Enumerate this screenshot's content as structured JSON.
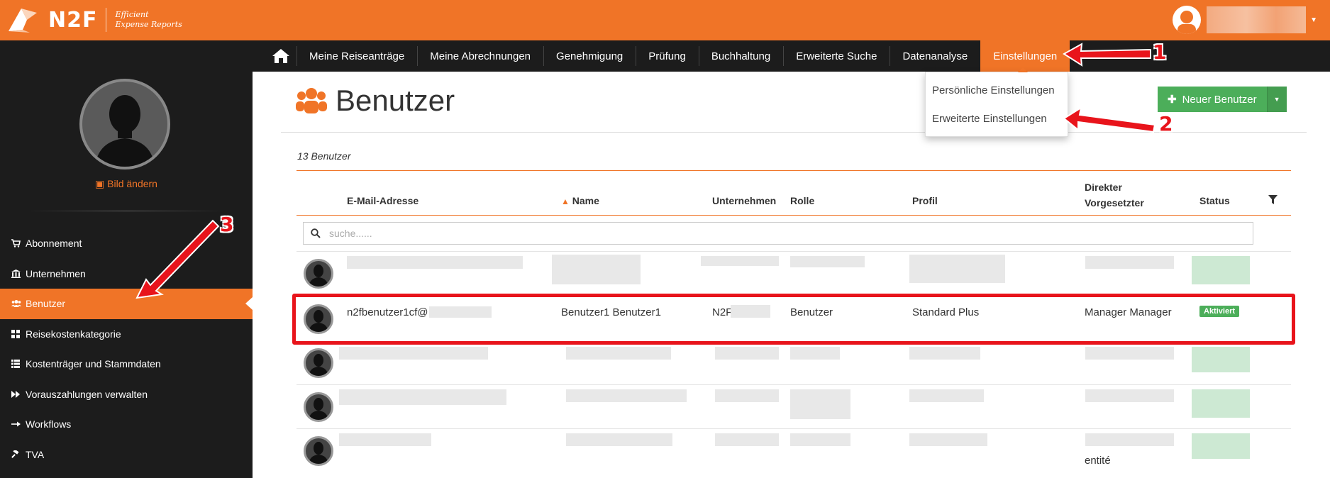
{
  "brand": {
    "name": "N2F",
    "tagline_line1": "Efficient",
    "tagline_line2": "Expense Reports"
  },
  "nav": {
    "items": [
      "Meine Reiseanträge",
      "Meine Abrechnungen",
      "Genehmigung",
      "Prüfung",
      "Buchhaltung",
      "Erweiterte Suche",
      "Datenanalyse",
      "Einstellungen"
    ],
    "active": "Einstellungen"
  },
  "dropdown": {
    "items": [
      "Persönliche Einstellungen",
      "Erweiterte Einstellungen"
    ]
  },
  "sidebar": {
    "change_picture": "Bild ändern",
    "items": [
      {
        "label": "Abonnement",
        "icon": "cart-icon"
      },
      {
        "label": "Unternehmen",
        "icon": "bank-icon"
      },
      {
        "label": "Benutzer",
        "icon": "users-icon",
        "active": true
      },
      {
        "label": "Reisekostenkategorie",
        "icon": "grid-icon"
      },
      {
        "label": "Kostenträger und Stammdaten",
        "icon": "list-icon"
      },
      {
        "label": "Vorauszahlungen verwalten",
        "icon": "fast-forward-icon"
      },
      {
        "label": "Workflows",
        "icon": "arrow-right-icon"
      },
      {
        "label": "TVA",
        "icon": "gavel-icon"
      }
    ]
  },
  "page": {
    "title": "Benutzer",
    "new_user_button": "Neuer Benutzer",
    "count": "13 Benutzer"
  },
  "table": {
    "headers": {
      "email": "E-Mail-Adresse",
      "name": "Name",
      "company": "Unternehmen",
      "role": "Rolle",
      "profile": "Profil",
      "manager_line1": "Direkter",
      "manager_line2": "Vorgesetzter",
      "status": "Status"
    },
    "search_placeholder": "suche......",
    "highlighted_row": {
      "email": "n2fbenutzer1cf@",
      "name": "Benutzer1 Benutzer1",
      "company": "N2F",
      "role": "Benutzer",
      "profile": "Standard Plus",
      "manager": "Manager Manager",
      "status": "Aktiviert"
    },
    "last_row_manager_fragment": "entité"
  },
  "annotations": {
    "one": "1",
    "two": "2",
    "three": "3"
  },
  "colors": {
    "accent": "#f07427",
    "nav_bg": "#1c1c1c",
    "success": "#4cae5a",
    "annotation": "#e8141b"
  }
}
